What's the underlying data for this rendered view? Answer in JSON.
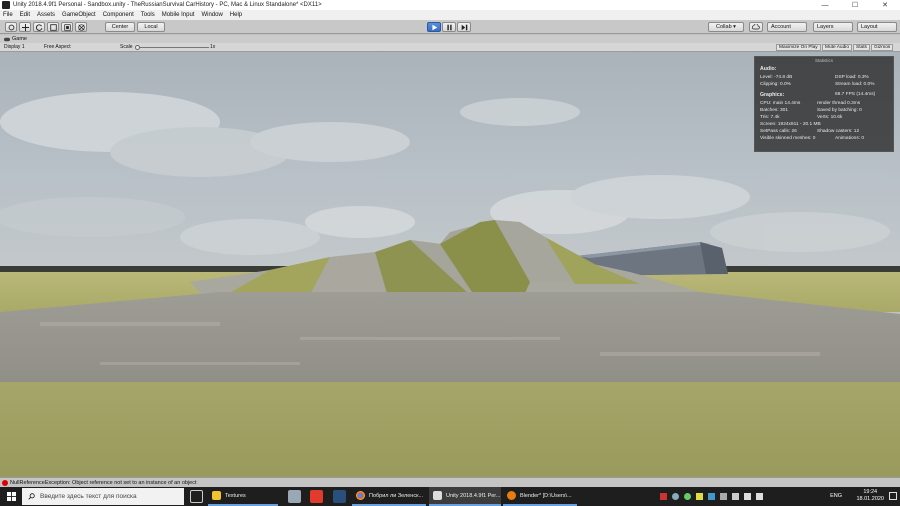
{
  "window": {
    "title": "Unity 2018.4.9f1 Personal - Sandbox.unity - TheRussianSurvival CarHistory - PC, Mac & Linux Standalone* <DX11>",
    "minimize": "—",
    "maximize": "☐",
    "close": "✕"
  },
  "menu": [
    "File",
    "Edit",
    "Assets",
    "GameObject",
    "Component",
    "Tools",
    "Mobile Input",
    "Window",
    "Help"
  ],
  "toolbar": {
    "center_label": "Center",
    "local_label": "Local",
    "collab_label": "Collab ▾",
    "account_label": "Account",
    "layers_label": "Layers",
    "layout_label": "Layout"
  },
  "game_tab": {
    "label": "Game",
    "display": "Display 1",
    "aspect": "Free Aspect",
    "scale_label": "Scale",
    "scale_value": "1x",
    "maximize_on_play": "Maximize On Play",
    "mute_audio": "Mute Audio",
    "stats": "Stats",
    "gizmos": "Gizmos"
  },
  "stats_overlay": {
    "header": "Statistics",
    "audio_title": "Audio:",
    "level": "Level: -74.8 dB",
    "clipping": "Clipping: 0.0%",
    "dsp_load": "DSP load: 0.3%",
    "stream_load": "Stream load: 0.0%",
    "graphics_title": "Graphics:",
    "fps": "69.7 FPS (14.4ms)",
    "cpu": "CPU: main 14.4ms",
    "render_thread": "render thread 0.3ms",
    "batches": "Batches: 301",
    "saved_batching": "Saved by batching: 0",
    "tris": "Tris: 7.4k",
    "verts": "Verts: 10.6k",
    "screen": "Screen: 1924x911 - 20.1 MB",
    "setpass": "SetPass calls: 26",
    "shadow_casters": "Shadow casters: 12",
    "visible_skinned": "Visible skinned meshes: 0",
    "animations": "Animations: 0"
  },
  "status": {
    "message": "NullReferenceException: Object reference not set to an instance of an object"
  },
  "taskbar": {
    "search_placeholder": "Введите здесь текст для поиска",
    "tasks": [
      {
        "label": "Textures"
      },
      {
        "label": "Побрил ли Зеленск..."
      },
      {
        "label": "Unity 2018.4.9f1 Per..."
      },
      {
        "label": "Blender* [D:\\Users\\..."
      }
    ],
    "lang": "ENG",
    "time": "19:24",
    "date": "18.01.2020"
  },
  "colors": {
    "accent": "#3a6fc0",
    "error": "#dd0000",
    "taskbar": "#1e1e1e"
  }
}
